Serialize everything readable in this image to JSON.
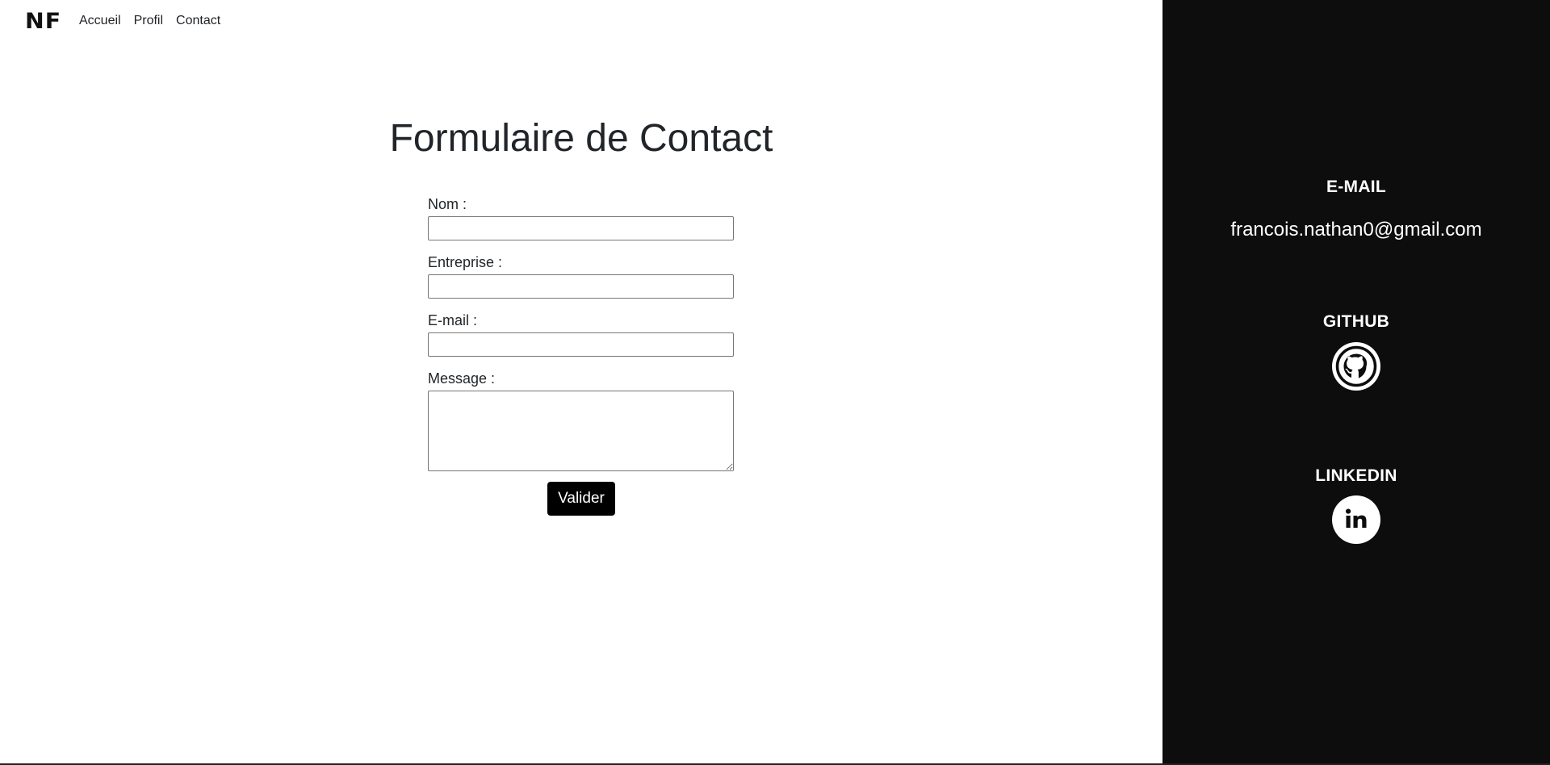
{
  "navbar": {
    "logo": "NF",
    "links": [
      {
        "label": "Accueil"
      },
      {
        "label": "Profil"
      },
      {
        "label": "Contact"
      }
    ]
  },
  "form": {
    "title": "Formulaire de Contact",
    "fields": {
      "nom": {
        "label": "Nom :",
        "value": ""
      },
      "entreprise": {
        "label": "Entreprise :",
        "value": ""
      },
      "email": {
        "label": "E-mail :",
        "value": ""
      },
      "message": {
        "label": "Message :",
        "value": ""
      }
    },
    "submit_label": "Valider"
  },
  "sidebar": {
    "email_heading": "E-MAIL",
    "email_value": "francois.nathan0@gmail.com",
    "github_heading": "GITHUB",
    "github_icon": "github-icon",
    "linkedin_heading": "LINKEDIN",
    "linkedin_icon": "linkedin-icon",
    "background_color": "#0d0d0d"
  },
  "colors": {
    "button": "#000000",
    "text": "#212529"
  }
}
